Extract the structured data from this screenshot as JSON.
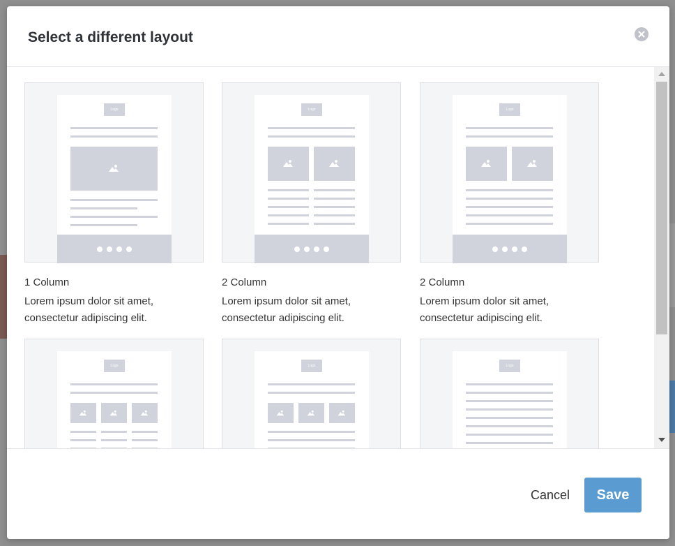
{
  "modal": {
    "title": "Select a different layout",
    "cancel_label": "Cancel",
    "save_label": "Save"
  },
  "layouts": [
    {
      "title": "1 Column",
      "description": "Lorem ipsum dolor sit amet, consectetur adipiscing elit."
    },
    {
      "title": "2 Column",
      "description": "Lorem ipsum dolor sit amet, consectetur adipiscing elit."
    },
    {
      "title": "2 Column",
      "description": "Lorem ipsum dolor sit amet, consectetur adipiscing elit."
    },
    {
      "title": "",
      "description": ""
    },
    {
      "title": "",
      "description": ""
    },
    {
      "title": "",
      "description": ""
    }
  ],
  "thumbnail": {
    "logo_text": "Logo"
  },
  "colors": {
    "placeholder": "#d0d3dc",
    "save_button": "#5a9cd2",
    "overlay": "#8f8f8f"
  }
}
